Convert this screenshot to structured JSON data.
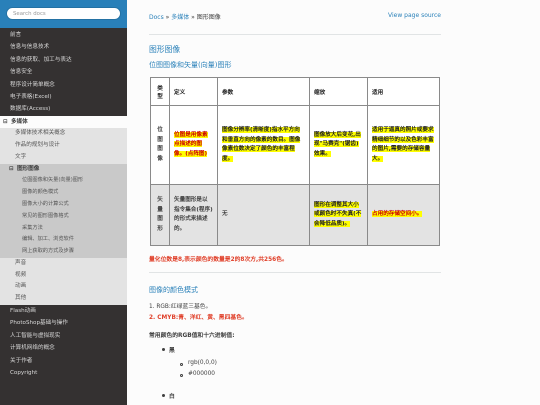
{
  "search": {
    "placeholder": "Search docs"
  },
  "sidebar": {
    "items": [
      {
        "label": "前言"
      },
      {
        "label": "信息与信息技术"
      },
      {
        "label": "信息的获取、加工与表达"
      },
      {
        "label": "信息安全"
      },
      {
        "label": "程序设计简单概念"
      },
      {
        "label": "电子表格(Excel)"
      },
      {
        "label": "数据库(Access)"
      }
    ],
    "current": {
      "label": "多媒体",
      "toggle": "⊟"
    },
    "sub": [
      {
        "label": "多媒体技术相关概念"
      },
      {
        "label": "作品的规划与设计"
      },
      {
        "label": "文字"
      }
    ],
    "current_sub": {
      "label": "图形图像",
      "toggle": "⊟"
    },
    "sub3": [
      {
        "label": "位图图像和矢量(向量)图形"
      },
      {
        "label": "图像的颜色模式"
      },
      {
        "label": "图像大小的计算公式"
      },
      {
        "label": "常见的图形图像格式"
      },
      {
        "label": "采集方法"
      },
      {
        "label": "编辑、加工、浏览软件"
      },
      {
        "label": "网上获取的方式及步骤"
      }
    ],
    "sub_after": [
      {
        "label": "声音"
      },
      {
        "label": "视频"
      },
      {
        "label": "动画"
      },
      {
        "label": "其他"
      }
    ],
    "after": [
      {
        "label": "Flash动画"
      },
      {
        "label": "PhotoShop基础与操作"
      },
      {
        "label": "人工智能与虚拟现实"
      },
      {
        "label": "计算机网络的概念"
      },
      {
        "label": "关于作者"
      },
      {
        "label": "Copyright"
      }
    ]
  },
  "breadcrumb": {
    "home": "Docs",
    "sep": "»",
    "parent": "多媒体",
    "current": "图形图像",
    "view_source": "View page source"
  },
  "headings": {
    "h1": "图形图像",
    "h2": "位图图像和矢量(向量)图形",
    "h3": "图像的颜色模式"
  },
  "table": {
    "headers": [
      "类型",
      "定义",
      "参数",
      "缩放",
      "适用"
    ],
    "rows": [
      {
        "type": "位图图像",
        "definition": "位图是用像素点描述的图像。(点阵图)",
        "params": "图像分辨率(清晰度)指水平方向和垂直方向的像素的数目。图像像素位数决定了颜色的丰富程度。",
        "scale": "图像放大后变花,出现\"马赛克\"(锯齿)效果。",
        "use": "适用于逼真的照片或要求精细细节的以及色彩丰富的图片,需要的存储容量大。"
      },
      {
        "type": "矢量图形",
        "definition": "矢量图形是以指令集合(程序)的形式来描述的。",
        "params": "无",
        "scale": "图形在调整其大小或颜色时不失真(不会降低品质)。",
        "use": "占用的存储空间小。"
      }
    ]
  },
  "note": "量化位数是8,表示颜色的数量是2的8次方,共256色。",
  "color_modes": {
    "items": [
      "1. RGB:红绿蓝三基色。",
      "2. CMYB:青、洋红、黄、黑四基色。"
    ],
    "caption": "常用颜色的RGB值和十六进制值:",
    "colors": [
      {
        "name": "黑",
        "rgb": "rgb(0,0,0)",
        "hex": "#000000"
      },
      {
        "name": "白"
      }
    ]
  }
}
